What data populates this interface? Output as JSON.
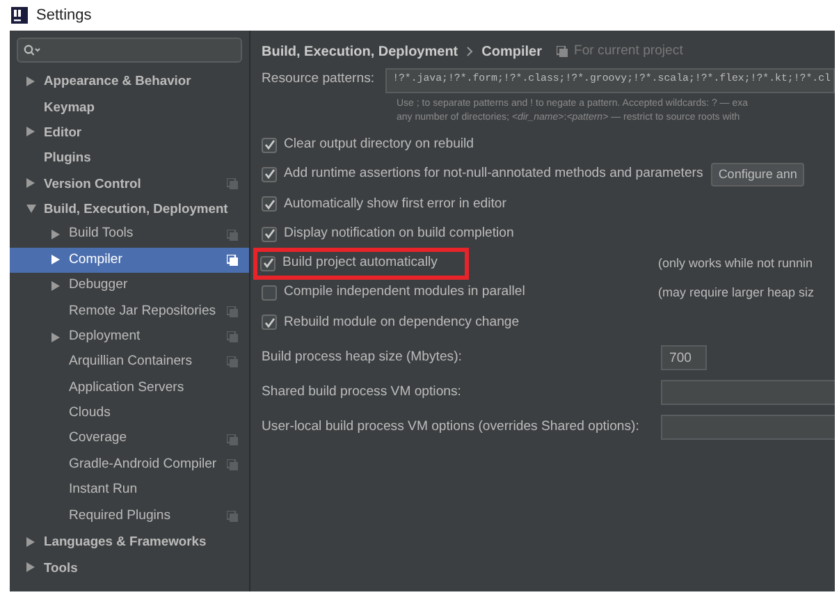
{
  "window": {
    "title": "Settings"
  },
  "sidebar": {
    "items": [
      {
        "label": "Appearance & Behavior",
        "expanded": false,
        "selected": false
      },
      {
        "label": "Keymap",
        "selected": false
      },
      {
        "label": "Editor",
        "expanded": false,
        "selected": false
      },
      {
        "label": "Plugins",
        "selected": false
      },
      {
        "label": "Version Control",
        "expanded": false,
        "project_scoped": true,
        "selected": false
      },
      {
        "label": "Build, Execution, Deployment",
        "expanded": true,
        "selected": false,
        "children": [
          {
            "label": "Build Tools",
            "expanded": false,
            "project_scoped": true,
            "selected": false
          },
          {
            "label": "Compiler",
            "expanded": false,
            "project_scoped": true,
            "selected": true
          },
          {
            "label": "Debugger",
            "expanded": false,
            "selected": false
          },
          {
            "label": "Remote Jar Repositories",
            "project_scoped": true,
            "selected": false
          },
          {
            "label": "Deployment",
            "expanded": false,
            "project_scoped": true,
            "selected": false
          },
          {
            "label": "Arquillian Containers",
            "project_scoped": true,
            "selected": false
          },
          {
            "label": "Application Servers",
            "selected": false
          },
          {
            "label": "Clouds",
            "selected": false
          },
          {
            "label": "Coverage",
            "project_scoped": true,
            "selected": false
          },
          {
            "label": "Gradle-Android Compiler",
            "project_scoped": true,
            "selected": false
          },
          {
            "label": "Instant Run",
            "selected": false
          },
          {
            "label": "Required Plugins",
            "project_scoped": true,
            "selected": false
          }
        ]
      },
      {
        "label": "Languages & Frameworks",
        "expanded": false,
        "selected": false
      },
      {
        "label": "Tools",
        "expanded": false,
        "selected": false
      }
    ]
  },
  "content": {
    "breadcrumb": [
      "Build, Execution, Deployment",
      "Compiler"
    ],
    "scope_note": "For current project",
    "resource_patterns": {
      "label": "Resource patterns:",
      "value": "!?*.java;!?*.form;!?*.class;!?*.groovy;!?*.scala;!?*.flex;!?*.kt;!?*.cl",
      "hint": [
        "Use ; to separate patterns and ! to negate a pattern. Accepted wildcards: ? — exa",
        "any number of directories; *<dir_name>*:*<pattern>* — restrict to source roots with"
      ]
    },
    "options": [
      {
        "label": "Clear output directory on rebuild",
        "checked": true
      },
      {
        "label": "Add runtime assertions for not-null-annotated methods and parameters",
        "checked": true,
        "button": "Configure ann"
      },
      {
        "label": "Automatically show first error in editor",
        "checked": true
      },
      {
        "label": "Display notification on build completion",
        "checked": true
      },
      {
        "label": "Build project automatically",
        "checked": true,
        "highlighted": true,
        "note": "(only works while not runnin"
      },
      {
        "label": "Compile independent modules in parallel",
        "checked": false,
        "note": "(may require larger heap siz"
      },
      {
        "label": "Rebuild module on dependency change",
        "checked": true
      }
    ],
    "fields": [
      {
        "label": "Build process heap size (Mbytes):",
        "value": "700",
        "kind": "short"
      },
      {
        "label": "Shared build process VM options:",
        "kind": "wide"
      },
      {
        "label": "User-local build process VM options (overrides Shared options):",
        "kind": "wide"
      }
    ]
  }
}
